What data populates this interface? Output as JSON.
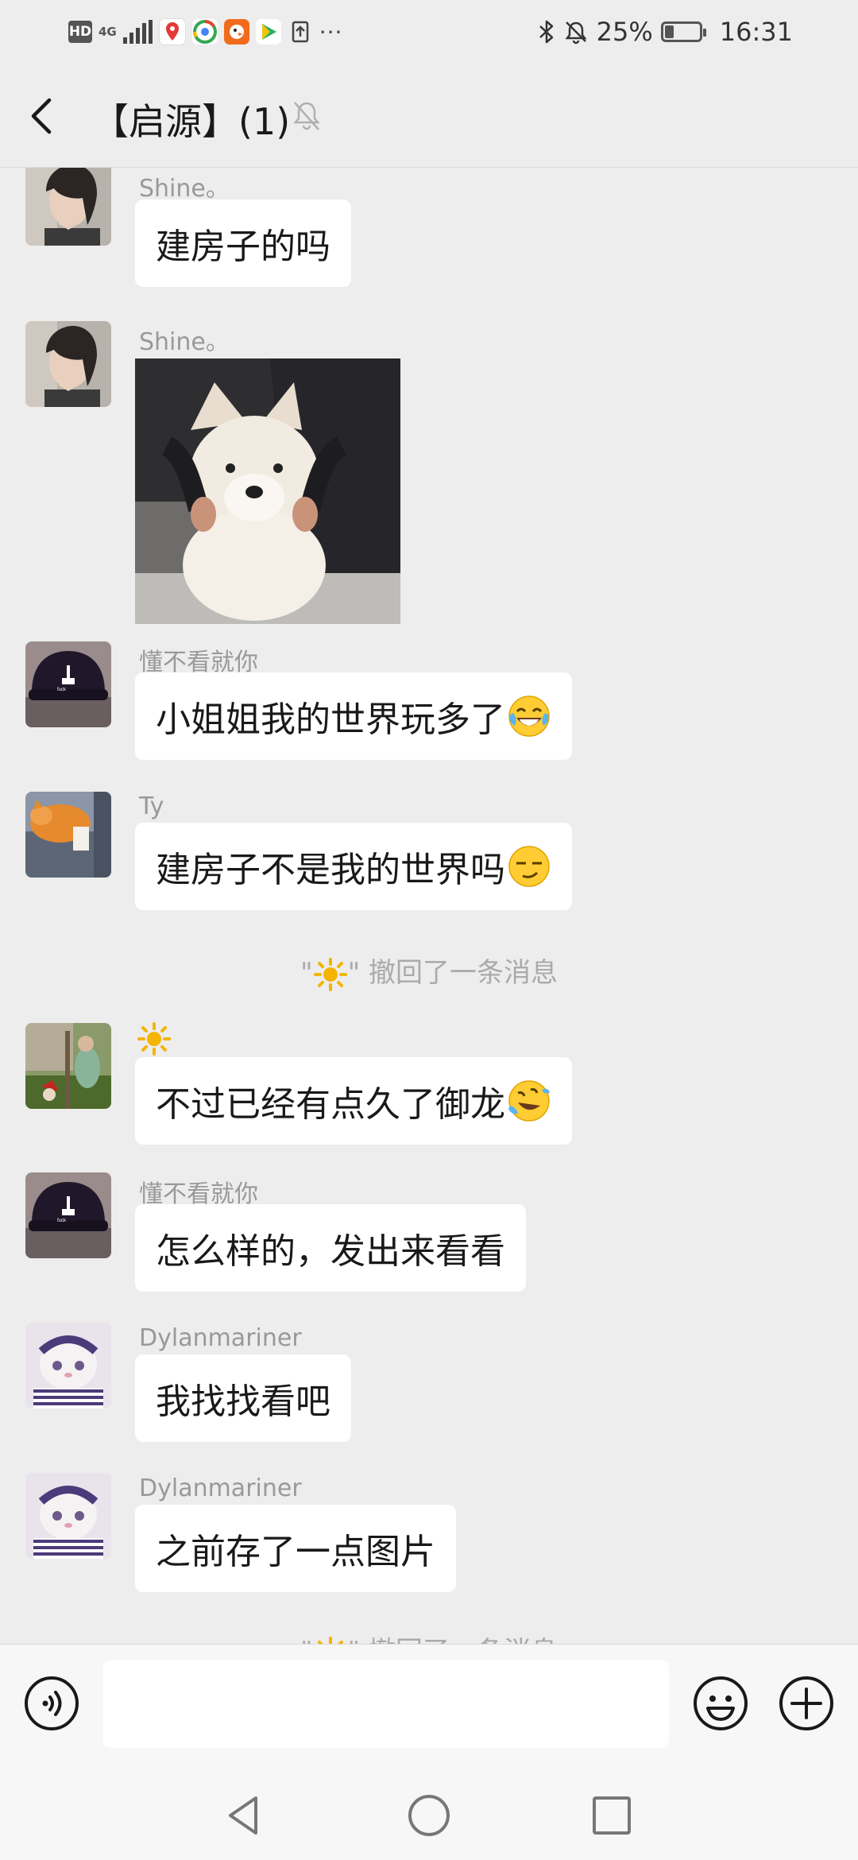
{
  "status_bar": {
    "hd": "HD",
    "network": "4G",
    "overflow": "···",
    "battery_text": "25%",
    "battery_level": 0.25,
    "time": "16:31"
  },
  "header": {
    "title": "【启源】(1)"
  },
  "messages": [
    {
      "sender": "Shine。",
      "text": "建房子的吗"
    },
    {
      "sender": "Shine。"
    },
    {
      "sender": "懂不看就你",
      "text": "小姐姐我的世界玩多了"
    },
    {
      "sender": "Ty",
      "text": "建房子不是我的世界吗"
    },
    {
      "sender": "",
      "text": "不过已经有点久了御龙"
    },
    {
      "sender": "懂不看就你",
      "text": "怎么样的，发出来看看"
    },
    {
      "sender": "Dylanmariner",
      "text": "我找找看吧"
    },
    {
      "sender": "Dylanmariner",
      "text": "之前存了一点图片"
    }
  ],
  "recalls": [
    {
      "pre": "\"",
      "post": "\" 撤回了一条消息"
    },
    {
      "pre": "\"",
      "post": "\" 撤回了一条消息"
    }
  ],
  "icons": {
    "back": "back-arrow-icon",
    "mute": "muted-bell-icon",
    "voice": "voice-icon",
    "emoji": "emoji-icon",
    "plus": "plus-icon",
    "sun": "sun-avatar-icon",
    "nav_back": "triangle-back-icon",
    "nav_home": "circle-home-icon",
    "nav_recent": "square-recent-icon"
  },
  "colors": {
    "background": "#ededed",
    "bubble": "#ffffff",
    "sender_name": "#999999",
    "system_text": "#aaaaaa",
    "sun": "#f4b400"
  }
}
